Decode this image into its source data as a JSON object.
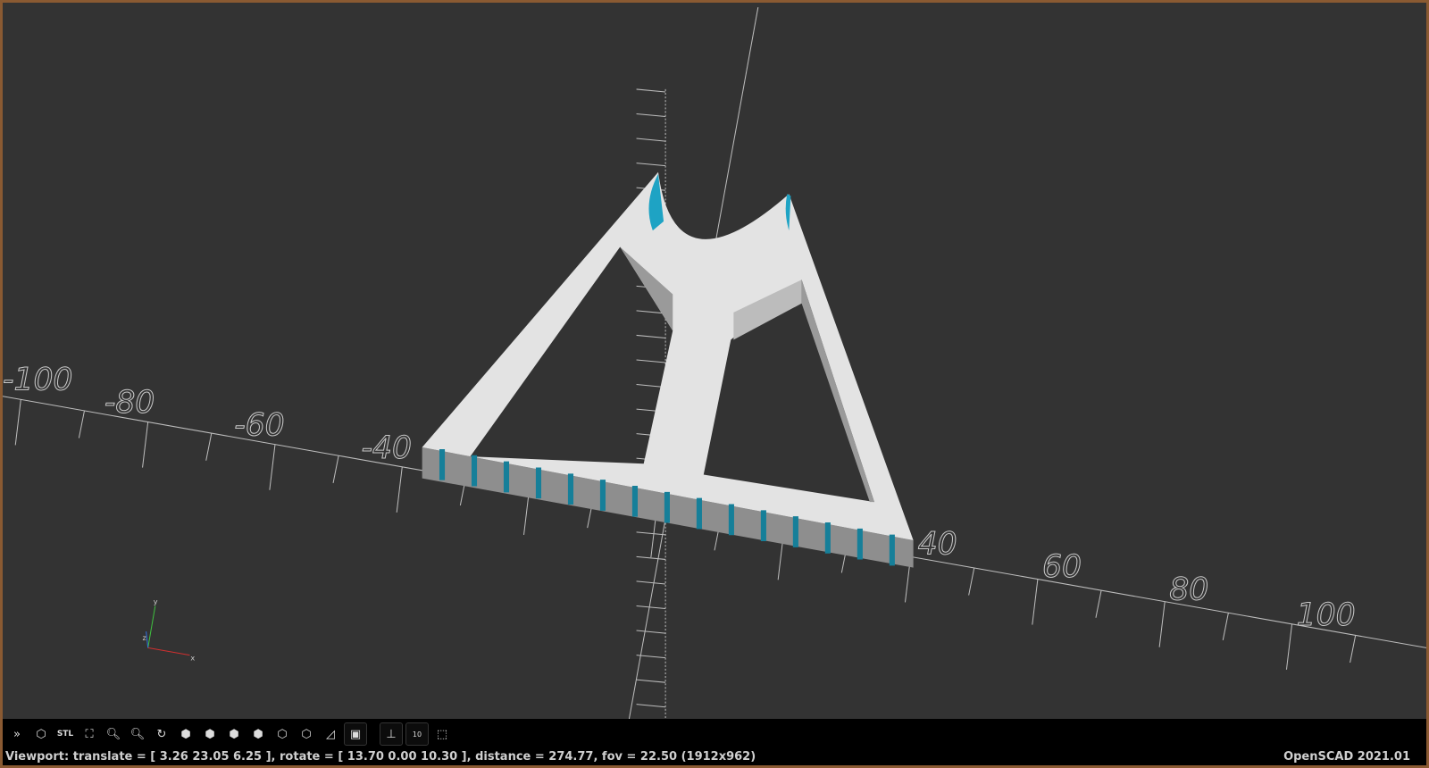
{
  "app": {
    "name": "OpenSCAD",
    "version_label": "OpenSCAD 2021.01"
  },
  "viewport": {
    "background": "#333333",
    "model_color": "#e6e6e6",
    "highlight_color": "#1ea3c4",
    "axis_labels": {
      "x_neg": [
        "-100",
        "-80",
        "-60",
        "-40"
      ],
      "x_pos": [
        "40",
        "60",
        "80",
        "100"
      ]
    },
    "axes_gizmo": {
      "x": "x",
      "y": "y",
      "z": "z"
    }
  },
  "toolbar": {
    "buttons": [
      {
        "name": "preview",
        "icon": "preview-icon"
      },
      {
        "name": "render",
        "icon": "render-icon"
      },
      {
        "name": "export-stl",
        "icon": "stl-icon",
        "label": "STL"
      },
      {
        "name": "view-all",
        "icon": "zoom-all-icon"
      },
      {
        "name": "zoom-in",
        "icon": "zoom-in-icon"
      },
      {
        "name": "zoom-out",
        "icon": "zoom-out-icon"
      },
      {
        "name": "reset-view",
        "icon": "reset-view-icon"
      },
      {
        "name": "view-right",
        "icon": "view-right-icon"
      },
      {
        "name": "view-top",
        "icon": "view-top-icon"
      },
      {
        "name": "view-bottom",
        "icon": "view-bottom-icon"
      },
      {
        "name": "view-left",
        "icon": "view-left-icon"
      },
      {
        "name": "view-front",
        "icon": "view-front-icon"
      },
      {
        "name": "view-back",
        "icon": "view-back-icon"
      },
      {
        "name": "perspective",
        "icon": "perspective-icon"
      },
      {
        "name": "orthogonal",
        "icon": "orthogonal-icon"
      },
      {
        "name": "show-axes",
        "icon": "axes-icon"
      },
      {
        "name": "show-scale",
        "icon": "scale-markers-icon",
        "label": "10"
      },
      {
        "name": "show-edges",
        "icon": "edges-icon"
      }
    ]
  },
  "status": {
    "viewport_text": "Viewport: translate = [ 3.26 23.05 6.25 ], rotate = [ 13.70 0.00 10.30 ], distance = 274.77, fov = 22.50 (1912x962)"
  }
}
